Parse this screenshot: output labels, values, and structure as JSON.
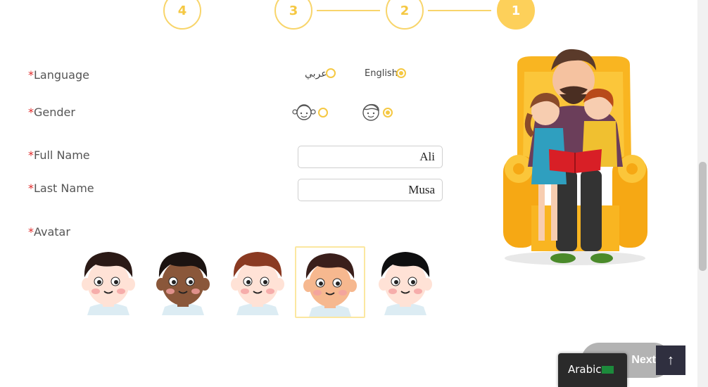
{
  "stepper": {
    "steps": [
      "4",
      "3",
      "2",
      "1"
    ],
    "active_step": "1"
  },
  "form": {
    "language": {
      "label": "Language",
      "required_mark": "*",
      "options": [
        {
          "label": "English",
          "checked": true
        },
        {
          "label": "عربي",
          "checked": false
        }
      ]
    },
    "gender": {
      "label": "Gender",
      "required_mark": "*",
      "options": [
        {
          "icon": "boy-face-icon",
          "checked": true
        },
        {
          "icon": "girl-face-icon",
          "checked": false
        }
      ]
    },
    "full_name": {
      "label": "Full Name",
      "required_mark": "*",
      "value": "Ali"
    },
    "last_name": {
      "label": "Last Name",
      "required_mark": "*",
      "value": "Musa"
    },
    "avatar": {
      "label": "Avatar",
      "required_mark": "*",
      "selected_index": 3,
      "options": [
        {
          "icon": "avatar-boy-curly-dark-hair-icon",
          "hair": "#2b1a16",
          "skin": "#ffe2d6"
        },
        {
          "icon": "avatar-boy-dark-skin-icon",
          "hair": "#1b1311",
          "skin": "#8a573a"
        },
        {
          "icon": "avatar-boy-auburn-hair-icon",
          "hair": "#8a3a22",
          "skin": "#ffe2d6"
        },
        {
          "icon": "avatar-boy-tan-skin-icon",
          "hair": "#3a1f1b",
          "skin": "#f6b88f"
        },
        {
          "icon": "avatar-boy-black-hair-icon",
          "hair": "#0f0f10",
          "skin": "#ffe2d6"
        }
      ]
    }
  },
  "actions": {
    "next_label": "Next",
    "language_switch_label": "Arabic",
    "scroll_top_icon": "arrow-up-icon"
  },
  "colors": {
    "accent": "#fdd05a",
    "required": "#e02b2b"
  }
}
